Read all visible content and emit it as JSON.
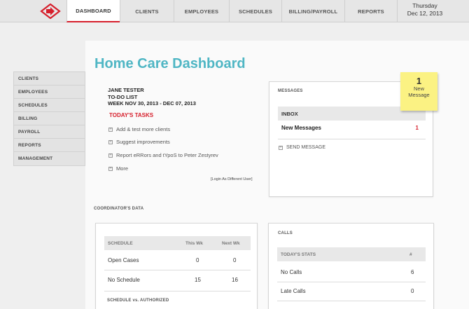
{
  "nav": {
    "items": [
      "DASHBOARD",
      "CLIENTS",
      "EMPLOYEES",
      "SCHEDULES",
      "BILLING/PAYROLL",
      "REPORTS"
    ],
    "active": "DASHBOARD",
    "day": "Thursday",
    "date": "Dec 12, 2013"
  },
  "sidebar": {
    "items": [
      "CLIENTS",
      "EMPLOYEES",
      "SCHEDULES",
      "BILLING",
      "PAYROLL",
      "REPORTS",
      "MANAGEMENT"
    ]
  },
  "page": {
    "title": "Home Care Dashboard"
  },
  "todo": {
    "name": "JANE TESTER",
    "list_label": "TO-DO LIST",
    "week": "WEEK NOV 30, 2013 - DEC 07, 2013",
    "todays_tasks": "TODAY'S TASKS",
    "tasks": [
      "Add & test more clients",
      "Suggest improvements",
      "Report eRRors and tYpoS to Peter Zestyrev",
      "More"
    ],
    "login_link": "[Login As Different User]"
  },
  "messages": {
    "label": "MESSAGES",
    "inbox": "INBOX",
    "new_messages_label": "New Messages",
    "new_messages_count": "1",
    "send": "SEND MESSAGE"
  },
  "sticky": {
    "count": "1",
    "line1": "New",
    "line2": "Message"
  },
  "coordinator": {
    "label": "COORDINATOR'S DATA"
  },
  "schedule": {
    "header": "SCHEDULE",
    "col1": "This Wk",
    "col2": "Next Wk",
    "rows": [
      {
        "label": "Open Cases",
        "this": "0",
        "next": "0"
      },
      {
        "label": "No Schedule",
        "this": "15",
        "next": "16"
      }
    ],
    "sub_header": "SCHEDULE vs. AUTHORIZED"
  },
  "calls": {
    "label": "CALLS",
    "header": "TODAY'S STATS",
    "col": "#",
    "rows": [
      {
        "label": "No Calls",
        "value": "6"
      },
      {
        "label": "Late Calls",
        "value": "0"
      }
    ]
  },
  "colors": {
    "accent": "#d61f2c",
    "title": "#4fb6c4",
    "sticky": "#fbf283"
  }
}
